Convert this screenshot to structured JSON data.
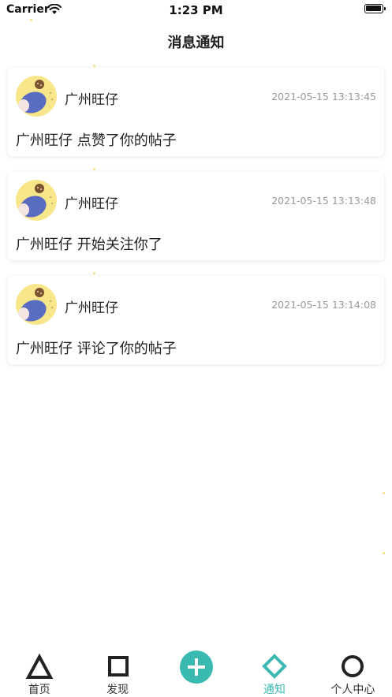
{
  "status_bar": {
    "carrier": "Carrier",
    "time": "1:23 PM"
  },
  "header": {
    "title": "消息通知"
  },
  "notifications": [
    {
      "user": "广州旺仔",
      "time": "2021-05-15 13:13:45",
      "message": "广州旺仔 点赞了你的帖子"
    },
    {
      "user": "广州旺仔",
      "time": "2021-05-15 13:13:48",
      "message": "广州旺仔 开始关注你了"
    },
    {
      "user": "广州旺仔",
      "time": "2021-05-15 13:14:08",
      "message": "广州旺仔 评论了你的帖子"
    }
  ],
  "tab_bar": {
    "items": [
      {
        "label": "首页",
        "icon": "triangle-icon"
      },
      {
        "label": "发现",
        "icon": "square-icon"
      },
      {
        "label": "",
        "icon": "plus-circle-icon"
      },
      {
        "label": "通知",
        "icon": "diamond-icon",
        "active": true
      },
      {
        "label": "个人中心",
        "icon": "circle-icon"
      }
    ],
    "accent_color": "#3ab9b1"
  }
}
